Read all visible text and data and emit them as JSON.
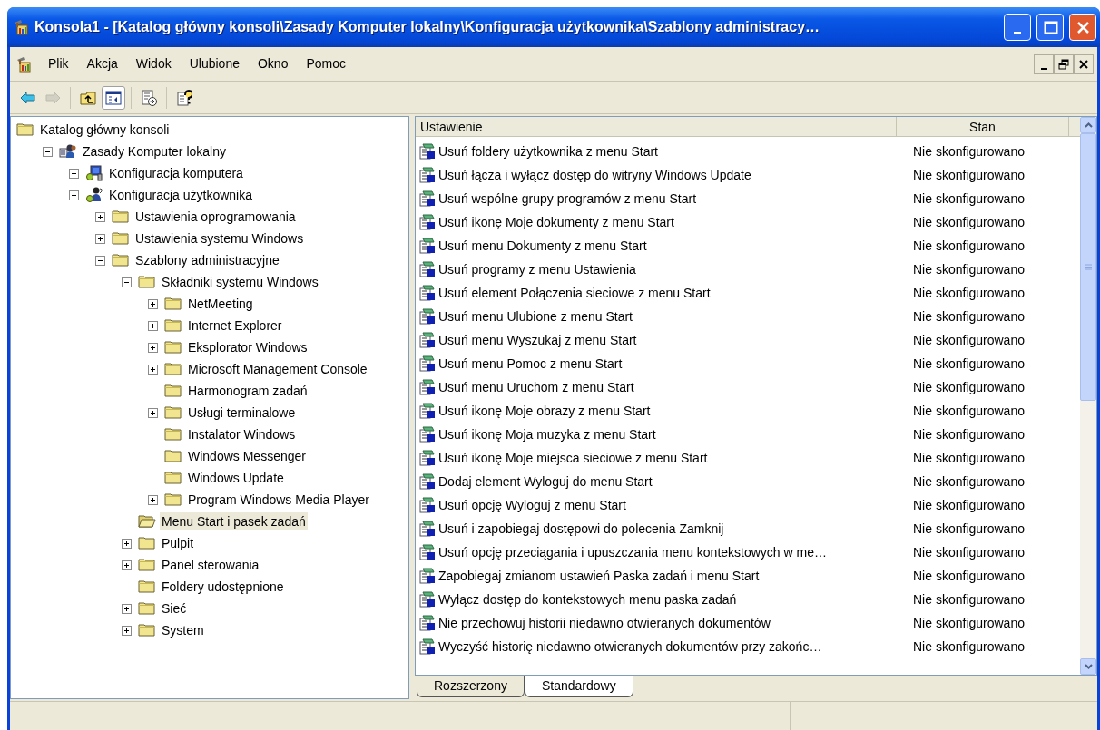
{
  "window": {
    "title": "Konsola1 - [Katalog główny konsoli\\Zasady Komputer lokalny\\Konfiguracja użytkownika\\Szablony administracy…"
  },
  "menu": [
    "Plik",
    "Akcja",
    "Widok",
    "Ulubione",
    "Okno",
    "Pomoc"
  ],
  "toolbar": [
    {
      "kind": "back",
      "disabled": false,
      "pressed": false
    },
    {
      "kind": "forward",
      "disabled": true,
      "pressed": false
    },
    {
      "kind": "up",
      "disabled": false,
      "pressed": false
    },
    {
      "kind": "tree",
      "disabled": false,
      "pressed": true
    },
    {
      "kind": "export",
      "disabled": false,
      "pressed": false
    },
    {
      "kind": "help",
      "disabled": false,
      "pressed": false
    }
  ],
  "tree": [
    {
      "label": "Katalog główny konsoli",
      "kind": "folder",
      "selected": false,
      "children": [
        {
          "label": "Zasady Komputer lokalny",
          "kind": "policy",
          "expanded": true,
          "selected": false,
          "children": [
            {
              "label": "Konfiguracja komputera",
              "kind": "computer",
              "expanded": false,
              "selected": false
            },
            {
              "label": "Konfiguracja użytkownika",
              "kind": "user",
              "expanded": true,
              "selected": false,
              "children": [
                {
                  "label": "Ustawienia oprogramowania",
                  "kind": "folder",
                  "expanded": false,
                  "selected": false
                },
                {
                  "label": "Ustawienia systemu Windows",
                  "kind": "folder",
                  "expanded": false,
                  "selected": false
                },
                {
                  "label": "Szablony administracyjne",
                  "kind": "folder",
                  "expanded": true,
                  "selected": false,
                  "children": [
                    {
                      "label": "Składniki systemu Windows",
                      "kind": "folder",
                      "expanded": true,
                      "selected": false,
                      "children": [
                        {
                          "label": "NetMeeting",
                          "kind": "folder",
                          "expanded": false,
                          "selected": false
                        },
                        {
                          "label": "Internet Explorer",
                          "kind": "folder",
                          "expanded": false,
                          "selected": false
                        },
                        {
                          "label": "Eksplorator Windows",
                          "kind": "folder",
                          "expanded": false,
                          "selected": false
                        },
                        {
                          "label": "Microsoft Management Console",
                          "kind": "folder",
                          "expanded": false,
                          "selected": false
                        },
                        {
                          "label": "Harmonogram zadań",
                          "kind": "folder",
                          "selected": false
                        },
                        {
                          "label": "Usługi terminalowe",
                          "kind": "folder",
                          "expanded": false,
                          "selected": false
                        },
                        {
                          "label": "Instalator Windows",
                          "kind": "folder",
                          "selected": false
                        },
                        {
                          "label": "Windows Messenger",
                          "kind": "folder",
                          "selected": false
                        },
                        {
                          "label": "Windows Update",
                          "kind": "folder",
                          "selected": false
                        },
                        {
                          "label": "Program Windows Media Player",
                          "kind": "folder",
                          "expanded": false,
                          "selected": false
                        }
                      ]
                    },
                    {
                      "label": "Menu Start i pasek zadań",
                      "kind": "open-folder",
                      "selected": true
                    },
                    {
                      "label": "Pulpit",
                      "kind": "folder",
                      "expanded": false,
                      "selected": false
                    },
                    {
                      "label": "Panel sterowania",
                      "kind": "folder",
                      "expanded": false,
                      "selected": false
                    },
                    {
                      "label": "Foldery udostępnione",
                      "kind": "folder",
                      "selected": false
                    },
                    {
                      "label": "Sieć",
                      "kind": "folder",
                      "expanded": false,
                      "selected": false
                    },
                    {
                      "label": "System",
                      "kind": "folder",
                      "expanded": false,
                      "selected": false
                    }
                  ]
                }
              ]
            }
          ]
        }
      ]
    }
  ],
  "table": {
    "columns": [
      "Ustawienie",
      "Stan"
    ],
    "rows": [
      {
        "setting": "Usuń foldery użytkownika z menu Start",
        "state": "Nie skonfigurowano"
      },
      {
        "setting": "Usuń łącza i wyłącz dostęp do witryny Windows Update",
        "state": "Nie skonfigurowano"
      },
      {
        "setting": "Usuń wspólne grupy programów z menu Start",
        "state": "Nie skonfigurowano"
      },
      {
        "setting": "Usuń ikonę Moje dokumenty z menu Start",
        "state": "Nie skonfigurowano"
      },
      {
        "setting": "Usuń menu Dokumenty z menu Start",
        "state": "Nie skonfigurowano"
      },
      {
        "setting": "Usuń programy z menu Ustawienia",
        "state": "Nie skonfigurowano"
      },
      {
        "setting": "Usuń element Połączenia sieciowe z menu Start",
        "state": "Nie skonfigurowano"
      },
      {
        "setting": "Usuń menu Ulubione z menu Start",
        "state": "Nie skonfigurowano"
      },
      {
        "setting": "Usuń menu Wyszukaj z menu Start",
        "state": "Nie skonfigurowano"
      },
      {
        "setting": "Usuń menu Pomoc z menu Start",
        "state": "Nie skonfigurowano"
      },
      {
        "setting": "Usuń menu Uruchom z menu Start",
        "state": "Nie skonfigurowano"
      },
      {
        "setting": "Usuń ikonę Moje obrazy z menu Start",
        "state": "Nie skonfigurowano"
      },
      {
        "setting": "Usuń ikonę Moja muzyka z menu Start",
        "state": "Nie skonfigurowano"
      },
      {
        "setting": "Usuń ikonę Moje miejsca sieciowe z menu Start",
        "state": "Nie skonfigurowano"
      },
      {
        "setting": "Dodaj element Wyloguj do menu Start",
        "state": "Nie skonfigurowano"
      },
      {
        "setting": "Usuń opcję Wyloguj z menu Start",
        "state": "Nie skonfigurowano"
      },
      {
        "setting": "Usuń i zapobiegaj dostępowi do polecenia Zamknij",
        "state": "Nie skonfigurowano"
      },
      {
        "setting": "Usuń opcję przeciągania i upuszczania menu kontekstowych w me…",
        "state": "Nie skonfigurowano"
      },
      {
        "setting": "Zapobiegaj zmianom ustawień Paska zadań i menu Start",
        "state": "Nie skonfigurowano"
      },
      {
        "setting": "Wyłącz dostęp do kontekstowych menu paska zadań",
        "state": "Nie skonfigurowano"
      },
      {
        "setting": "Nie przechowuj historii niedawno otwieranych dokumentów",
        "state": "Nie skonfigurowano"
      },
      {
        "setting": "Wyczyść historię niedawno otwieranych dokumentów przy zakońc…",
        "state": "Nie skonfigurowano"
      }
    ]
  },
  "view_tabs": [
    {
      "label": "Rozszerzony",
      "selected": false
    },
    {
      "label": "Standardowy",
      "selected": true
    }
  ]
}
